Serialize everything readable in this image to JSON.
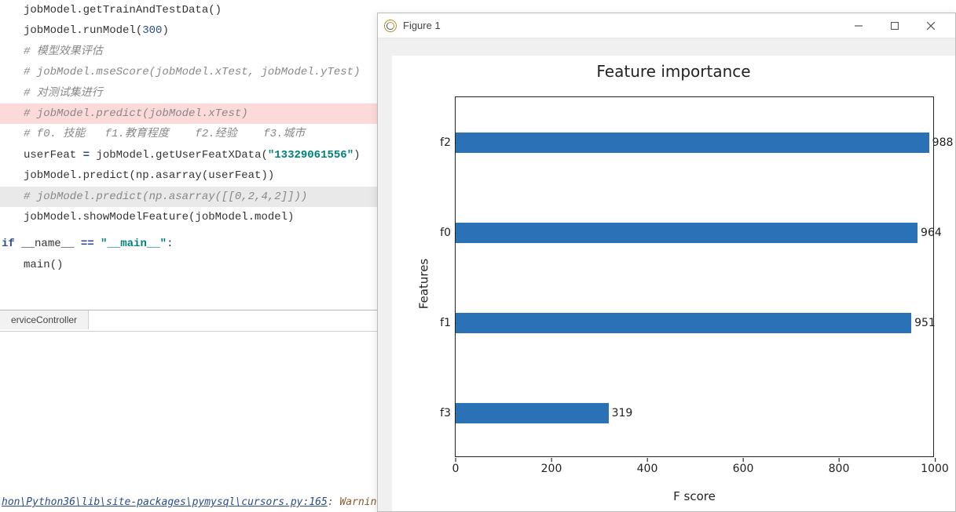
{
  "editor": {
    "lines": [
      {
        "cls": "",
        "html": "jobModel.getTrainAndTestData()"
      },
      {
        "cls": "",
        "html": "jobModel.runModel(<span class='number'>300</span>)"
      },
      {
        "cls": "comment",
        "html": "# 模型效果评估"
      },
      {
        "cls": "comment",
        "html": "# jobModel.mseScore(jobModel.xTest, jobModel.yTest)"
      },
      {
        "cls": "comment",
        "html": "# 对测试集进行"
      },
      {
        "cls": "comment hl-red",
        "html": "# jobModel.predict(jobModel.xTest)"
      },
      {
        "cls": "comment",
        "html": "# f0. 技能   f1.教育程度    f2.经验    f3.城市"
      },
      {
        "cls": "",
        "html": "userFeat <span class='keyword'>=</span> jobModel.getUserFeatXData(<span class='string'>\"13329061556\"</span>)"
      },
      {
        "cls": "",
        "html": "jobModel.predict(np.asarray(userFeat))"
      },
      {
        "cls": "comment hl-grey",
        "html": "# jobModel.predict(np.asarray([[0,2,4,2]]))"
      },
      {
        "cls": "",
        "html": "jobModel.showModelFeature(jobModel.model)"
      },
      {
        "cls": "",
        "html": ""
      },
      {
        "cls": "",
        "html": ""
      },
      {
        "cls": "unindent",
        "html": "<span class='keyword'>if</span> __name__ <span class='keyword'>==</span> <span class='string'>\"__main__\"</span>:"
      },
      {
        "cls": "",
        "html": "main()"
      }
    ]
  },
  "tab": {
    "label": "erviceController"
  },
  "console": {
    "path": "hon\\Python36\\lib\\site-packages\\pymysql\\cursors.py:165",
    "msg": ": Warnin"
  },
  "figure": {
    "window_title": "Figure 1"
  },
  "chart_data": {
    "type": "bar",
    "orientation": "horizontal",
    "title": "Feature importance",
    "xlabel": "F score",
    "ylabel": "Features",
    "categories": [
      "f2",
      "f0",
      "f1",
      "f3"
    ],
    "values": [
      988,
      964,
      951,
      319
    ],
    "xlim": [
      0,
      1000
    ],
    "xticks": [
      0,
      200,
      400,
      600,
      800,
      1000
    ],
    "bar_color": "#2a72b5"
  }
}
